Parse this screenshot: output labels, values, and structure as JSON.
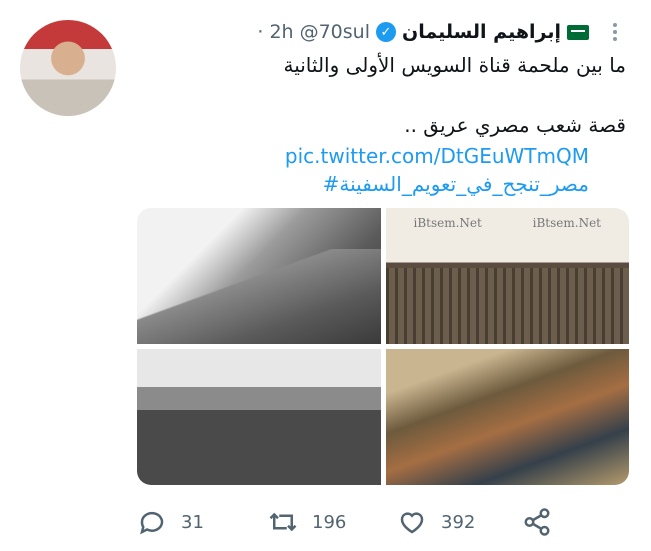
{
  "author": {
    "name": "إبراهيم السليمان",
    "handle": "@70sul",
    "time": "· 2h"
  },
  "tweet": {
    "line1": "ما بين ملحمة قناة السويس الأولى والثانية",
    "line2": "قصة شعب مصري عريق ..",
    "hashtag": "#مصر_تنجح_في_تعويم_السفينة",
    "link": "pic.twitter.com/DtGEuWTmQM"
  },
  "media": {
    "watermark_left": "iBtsem.Net",
    "watermark_right": "iBtsem.Net"
  },
  "actions": {
    "replies": "31",
    "retweets": "196",
    "likes": "392"
  },
  "icons": [
    "more-icon",
    "verified-icon",
    "flag-icon",
    "reply-icon",
    "retweet-icon",
    "like-icon",
    "share-icon"
  ],
  "colors": {
    "link": "#1d9bf0",
    "secondary_text": "#536471",
    "verified": "#1d9bf0"
  }
}
